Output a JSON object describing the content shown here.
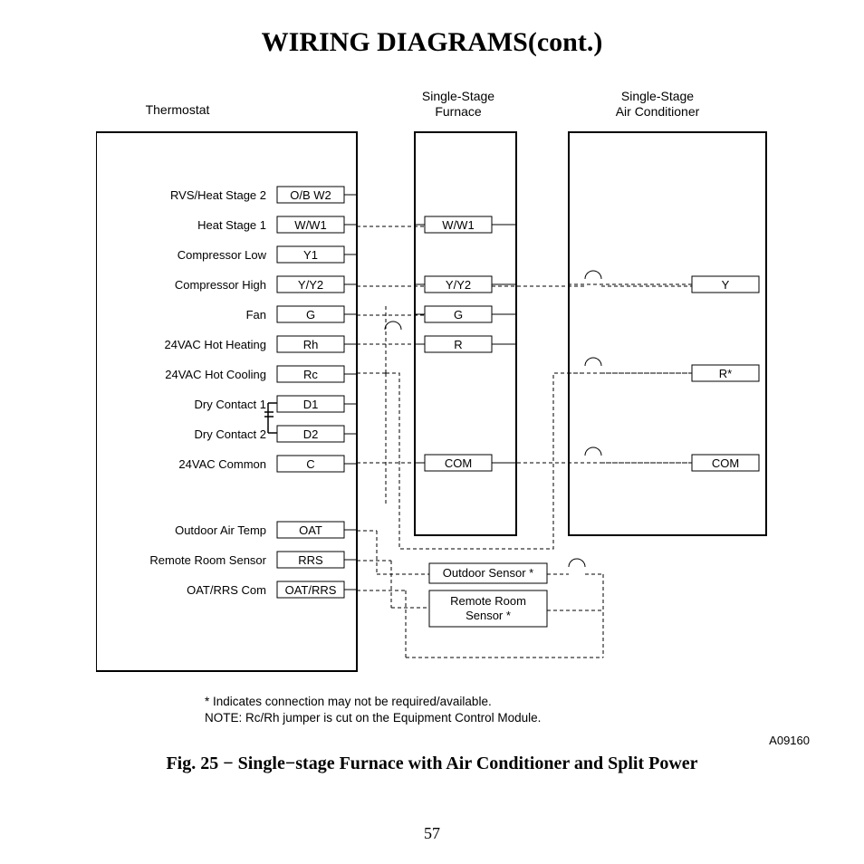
{
  "title": "WIRING DIAGRAMS(cont.)",
  "headers": {
    "thermostat": "Thermostat",
    "furnace1": "Single-Stage",
    "furnace2": "Furnace",
    "ac1": "Single-Stage",
    "ac2": "Air Conditioner"
  },
  "thermostat_rows": [
    {
      "label": "RVS/Heat Stage 2",
      "term": "O/B W2"
    },
    {
      "label": "Heat Stage 1",
      "term": "W/W1"
    },
    {
      "label": "Compressor Low",
      "term": "Y1"
    },
    {
      "label": "Compressor High",
      "term": "Y/Y2"
    },
    {
      "label": "Fan",
      "term": "G"
    },
    {
      "label": "24VAC Hot Heating",
      "term": "Rh"
    },
    {
      "label": "24VAC Hot Cooling",
      "term": "Rc"
    },
    {
      "label": "Dry Contact 1",
      "term": "D1"
    },
    {
      "label": "Dry Contact 2",
      "term": "D2"
    },
    {
      "label": "24VAC Common",
      "term": "C"
    }
  ],
  "sensor_rows": [
    {
      "label": "Outdoor Air Temp",
      "term": "OAT"
    },
    {
      "label": "Remote Room Sensor",
      "term": "RRS"
    },
    {
      "label": "OAT/RRS Com",
      "term": "OAT/RRS"
    }
  ],
  "furnace_terms": [
    "W/W1",
    "Y/Y2",
    "G",
    "R",
    "COM"
  ],
  "ac_terms": [
    "Y",
    "R*",
    "COM"
  ],
  "sensor_boxes": {
    "outdoor": "Outdoor Sensor *",
    "remote1": "Remote Room",
    "remote2": "Sensor  *"
  },
  "notes": {
    "line1": "*  Indicates connection may not be required/available.",
    "line2": "NOTE:  Rc/Rh jumper is cut on the Equipment Control Module."
  },
  "code": "A09160",
  "caption": "Fig. 25 − Single−stage Furnace with Air Conditioner and Split Power",
  "page_number": "57"
}
